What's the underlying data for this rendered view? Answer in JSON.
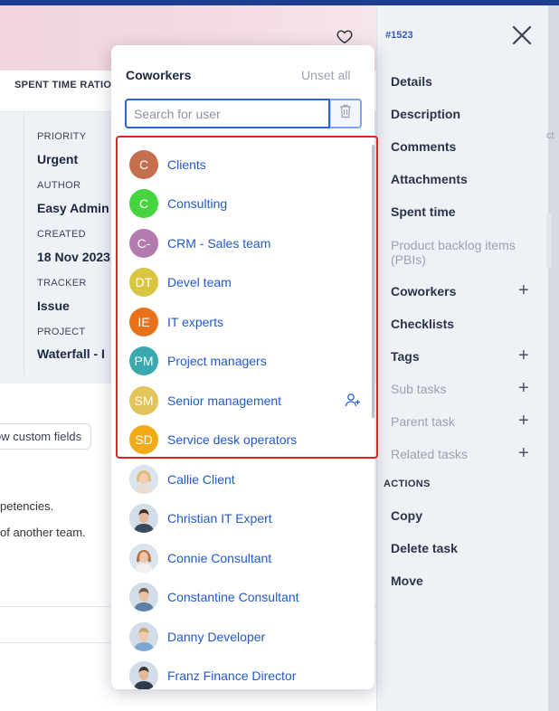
{
  "background": {
    "spent_time_ratio": "SPENT TIME RATIO",
    "fields": [
      {
        "label": "PRIORITY",
        "value": "Urgent"
      },
      {
        "label": "AUTHOR",
        "value": "Easy Admin"
      },
      {
        "label": "CREATED",
        "value": "18 Nov 2023"
      },
      {
        "label": "TRACKER",
        "value": "Issue"
      },
      {
        "label": "PROJECT",
        "value": "Waterfall - I"
      }
    ],
    "show_custom_fields": "ow custom fields",
    "text_lines": [
      "petencies.",
      " of another team."
    ]
  },
  "side_panel": {
    "issue_id": "#1523",
    "items": [
      {
        "label": "Details",
        "muted": false,
        "plus": false
      },
      {
        "label": "Description",
        "muted": false,
        "plus": false
      },
      {
        "label": "Comments",
        "muted": false,
        "plus": false
      },
      {
        "label": "Attachments",
        "muted": false,
        "plus": false
      },
      {
        "label": "Spent time",
        "muted": false,
        "plus": false
      },
      {
        "label": "Product backlog items (PBIs)",
        "muted": true,
        "plus": false
      },
      {
        "label": "Coworkers",
        "muted": false,
        "plus": true
      },
      {
        "label": "Checklists",
        "muted": false,
        "plus": false
      },
      {
        "label": "Tags",
        "muted": false,
        "plus": true
      },
      {
        "label": "Sub tasks",
        "muted": true,
        "plus": true
      },
      {
        "label": "Parent task",
        "muted": true,
        "plus": true
      },
      {
        "label": "Related tasks",
        "muted": true,
        "plus": true
      }
    ],
    "actions_label": "ACTIONS",
    "actions": [
      "Copy",
      "Delete task",
      "Move"
    ],
    "right_edge_text": "ct"
  },
  "dropdown": {
    "title": "Coworkers",
    "unset_all": "Unset all",
    "search_placeholder": "Search for user",
    "groups": [
      {
        "initials": "C",
        "name": "Clients",
        "color": "#c56f4e"
      },
      {
        "initials": "C",
        "name": "Consulting",
        "color": "#45d540"
      },
      {
        "initials": "C-",
        "name": "CRM - Sales team",
        "color": "#b27aae"
      },
      {
        "initials": "DT",
        "name": "Devel team",
        "color": "#d8c542"
      },
      {
        "initials": "IE",
        "name": "IT experts",
        "color": "#e8711c"
      },
      {
        "initials": "PM",
        "name": "Project managers",
        "color": "#3ba8b0"
      },
      {
        "initials": "SM",
        "name": "Senior management",
        "color": "#e3c45a"
      },
      {
        "initials": "SD",
        "name": "Service desk operators",
        "color": "#f1ab18"
      }
    ],
    "users": [
      {
        "name": "Callie Client",
        "hair": "#e0b878",
        "skin": "#f2cdb0"
      },
      {
        "name": "Christian IT Expert",
        "hair": "#3c2e26",
        "skin": "#e7b99a"
      },
      {
        "name": "Connie Consultant",
        "hair": "#b7713e",
        "skin": "#f0c4a6"
      },
      {
        "name": "Constantine Consultant",
        "hair": "#6e5a44",
        "skin": "#e9c1a5"
      },
      {
        "name": "Danny Developer",
        "hair": "#c7a06e",
        "skin": "#efcab0"
      },
      {
        "name": "Franz Finance Director",
        "hair": "#3a3530",
        "skin": "#e4b898"
      }
    ]
  }
}
